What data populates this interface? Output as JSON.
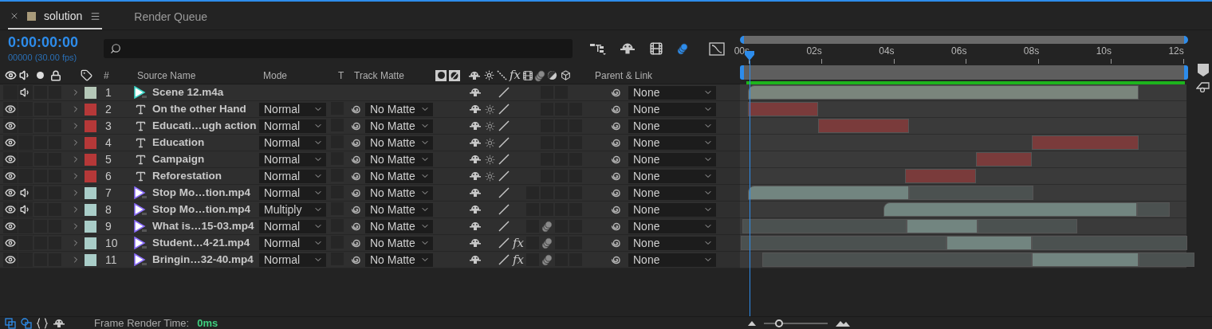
{
  "tabs": [
    {
      "label": "solution",
      "selected": true,
      "kind": "composition",
      "color": "#a89a7a"
    },
    {
      "label": "Render Queue",
      "selected": false,
      "kind": "panel"
    }
  ],
  "timecode": "0:00:00:00",
  "frame_info": "00000 (30.00 fps)",
  "zoom": {
    "level": 0.2
  },
  "header": {
    "number": "#",
    "source_name": "Source Name",
    "mode": "Mode",
    "t": "T",
    "track_matte": "Track Matte",
    "fx": "fx",
    "parent": "Parent & Link"
  },
  "ruler": {
    "ticks": [
      "00s",
      "02s",
      "04s",
      "06s",
      "08s",
      "10s",
      "12s"
    ]
  },
  "layers": [
    {
      "number": "1",
      "name": "Scene 12.m4a",
      "kind": "audio",
      "color": "#b5c8b8",
      "video": false,
      "audio": true,
      "solo": false,
      "locked": false,
      "parent": "None",
      "motion_blur": false
    },
    {
      "number": "2",
      "name": "On the other Hand",
      "kind": "text",
      "color": "#b53838",
      "video": true,
      "audio": false,
      "solo": false,
      "locked": false,
      "mode": "Normal",
      "matte": "No Matte",
      "parent": "None",
      "motion_blur": false
    },
    {
      "number": "3",
      "name": "Educati…ugh action",
      "kind": "text",
      "color": "#b53838",
      "video": true,
      "audio": false,
      "solo": false,
      "locked": false,
      "mode": "Normal",
      "matte": "No Matte",
      "parent": "None",
      "motion_blur": false
    },
    {
      "number": "4",
      "name": "Education",
      "kind": "text",
      "color": "#b53838",
      "video": true,
      "audio": false,
      "solo": false,
      "locked": false,
      "mode": "Normal",
      "matte": "No Matte",
      "parent": "None",
      "motion_blur": false
    },
    {
      "number": "5",
      "name": "Campaign",
      "kind": "text",
      "color": "#b53838",
      "video": true,
      "audio": false,
      "solo": false,
      "locked": false,
      "mode": "Normal",
      "matte": "No Matte",
      "parent": "None",
      "motion_blur": false
    },
    {
      "number": "6",
      "name": "Reforestation",
      "kind": "text",
      "color": "#b53838",
      "video": true,
      "audio": false,
      "solo": false,
      "locked": false,
      "mode": "Normal",
      "matte": "No Matte",
      "parent": "None",
      "motion_blur": false
    },
    {
      "number": "7",
      "name": "Stop Mo…tion.mp4",
      "kind": "video",
      "color": "#a9cdc8",
      "video": true,
      "audio": true,
      "solo": false,
      "locked": false,
      "mode": "Normal",
      "matte": "No Matte",
      "parent": "None",
      "motion_blur": false
    },
    {
      "number": "8",
      "name": "Stop Mo…tion.mp4",
      "kind": "video",
      "color": "#a9cdc8",
      "video": true,
      "audio": true,
      "solo": false,
      "locked": false,
      "mode": "Multiply",
      "matte": "No Matte",
      "parent": "None",
      "motion_blur": false
    },
    {
      "number": "9",
      "name": "What is…15-03.mp4",
      "kind": "video",
      "color": "#a9cdc8",
      "video": true,
      "audio": false,
      "solo": false,
      "locked": false,
      "mode": "Normal",
      "matte": "No Matte",
      "parent": "None",
      "motion_blur": true
    },
    {
      "number": "10",
      "name": "Student…4-21.mp4",
      "kind": "video",
      "color": "#a9cdc8",
      "video": true,
      "audio": false,
      "solo": false,
      "locked": false,
      "mode": "Normal",
      "matte": "No Matte",
      "parent": "None",
      "motion_blur": true,
      "effects": {
        "label": "fx",
        "on": true
      }
    },
    {
      "number": "11",
      "name": "Bringin…32-40.mp4",
      "kind": "video",
      "color": "#a9cdc8",
      "video": true,
      "audio": false,
      "solo": false,
      "locked": false,
      "mode": "Normal",
      "matte": "No Matte",
      "parent": "None",
      "motion_blur": true,
      "effects": {
        "label": "fx",
        "on": true
      }
    }
  ],
  "status": {
    "label": "Frame Render Time:",
    "value": "0ms"
  }
}
